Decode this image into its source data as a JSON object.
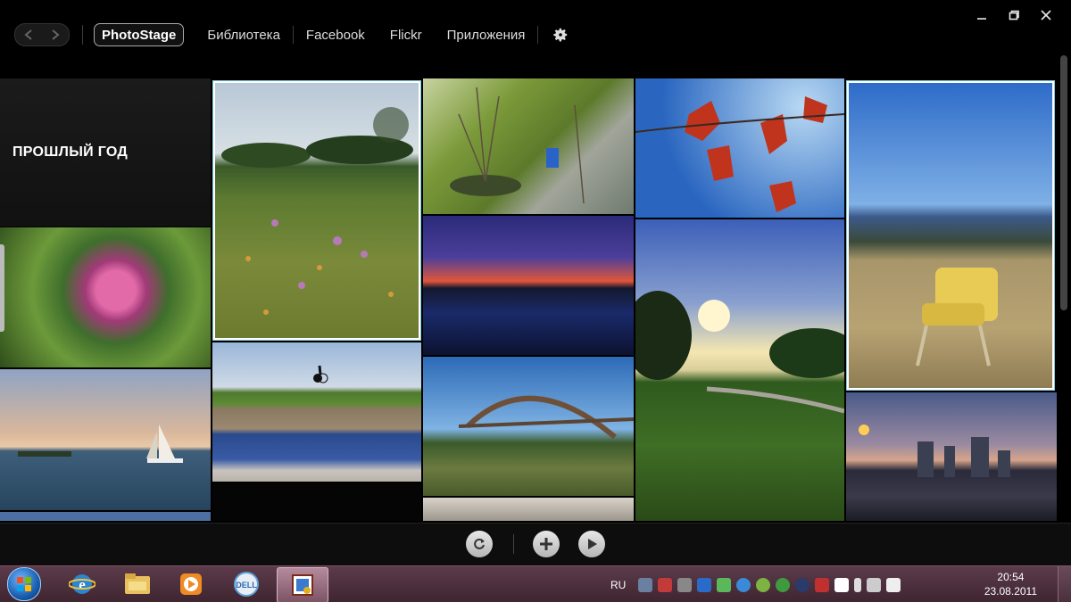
{
  "window": {
    "controls": {
      "minimize_icon": "minimize-icon",
      "maximize_icon": "maximize-icon",
      "close_icon": "close-icon"
    }
  },
  "nav": {
    "back_icon": "chevron-left-icon",
    "forward_icon": "chevron-right-icon",
    "items": [
      {
        "label": "PhotoStage",
        "active": true
      },
      {
        "label": "Библиотека"
      },
      {
        "label": "Facebook"
      },
      {
        "label": "Flickr"
      },
      {
        "label": "Приложения"
      }
    ],
    "settings_icon": "gear-icon"
  },
  "gallery": {
    "section_title": "ПРОШЛЫЙ ГОД",
    "photos": [
      {
        "name": "pink-flower",
        "subject": "pink flower"
      },
      {
        "name": "sailboat",
        "subject": "sailboat on lake"
      },
      {
        "name": "wildflower-field",
        "subject": "wildflower meadow",
        "selected": true
      },
      {
        "name": "cyclist-bluebonnets",
        "subject": "cyclist and bluebonnets"
      },
      {
        "name": "park-trees",
        "subject": "sunlit park"
      },
      {
        "name": "lake-sunset",
        "subject": "lake at dusk"
      },
      {
        "name": "bridge",
        "subject": "arch bridge"
      },
      {
        "name": "red-leaves",
        "subject": "red maple leaves"
      },
      {
        "name": "sunset-field",
        "subject": "sunset over field"
      },
      {
        "name": "yellow-chair",
        "subject": "yellow chair in field",
        "selected": true
      },
      {
        "name": "city-skyline",
        "subject": "city skyline at dusk"
      }
    ]
  },
  "toolbar": {
    "rotate_icon": "rotate-icon",
    "add_icon": "plus-icon",
    "play_icon": "play-icon"
  },
  "taskbar": {
    "start_icon": "windows-start-icon",
    "apps": [
      "ie-icon",
      "folder-icon",
      "media-player-icon",
      "dell-icon",
      "photostage-icon"
    ],
    "language": "RU",
    "time": "20:54",
    "date": "23.08.2011"
  },
  "colors": {
    "selection_border": "#ffffff",
    "taskbar": "#4e3040"
  }
}
